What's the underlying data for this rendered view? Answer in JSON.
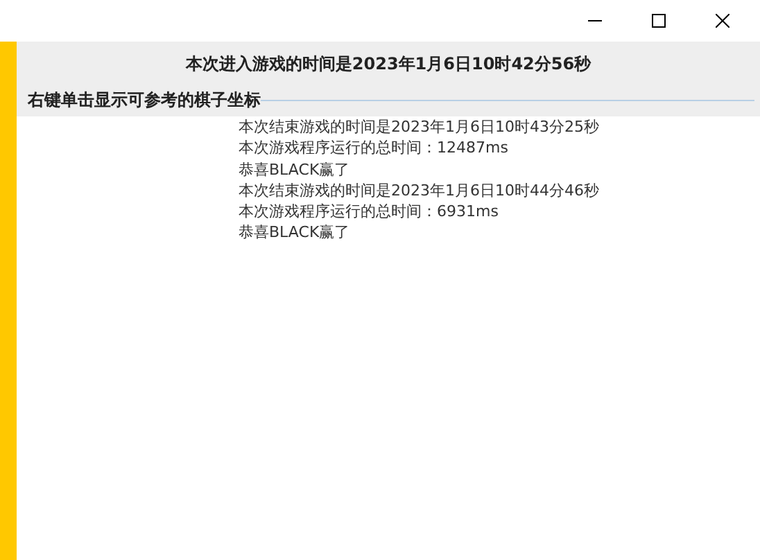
{
  "window": {
    "buttons": [
      {
        "kind": "minimize"
      },
      {
        "kind": "maximize"
      },
      {
        "kind": "close"
      }
    ]
  },
  "header": {
    "title": "本次进入游戏的时间是2023年1月6日10时42分56秒",
    "group_label": "右键单击显示可参考的棋子坐标"
  },
  "log": [
    "本次结束游戏的时间是2023年1月6日10时43分25秒",
    "本次游戏程序运行的总时间：12487ms",
    "恭喜BLACK赢了",
    "本次结束游戏的时间是2023年1月6日10时44分46秒",
    "本次游戏程序运行的总时间：6931ms",
    "恭喜BLACK赢了"
  ]
}
